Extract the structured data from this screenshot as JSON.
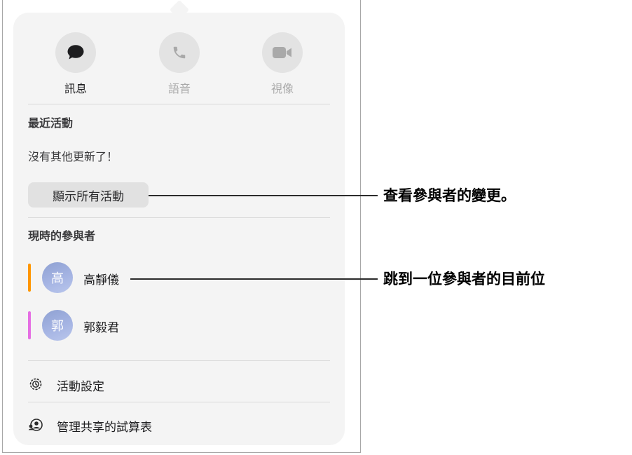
{
  "comm_types": [
    {
      "label": "訊息",
      "icon": "message-bubble-icon",
      "active": true
    },
    {
      "label": "語音",
      "icon": "phone-icon",
      "active": false
    },
    {
      "label": "視像",
      "icon": "video-camera-icon",
      "active": false
    }
  ],
  "recent_activity": {
    "heading": "最近活動",
    "empty_text": "沒有其他更新了！",
    "show_all_button": "顯示所有活動"
  },
  "participants": {
    "heading": "現時的參與者",
    "items": [
      {
        "initial": "高",
        "name": "高靜儀",
        "color": "#ff9500"
      },
      {
        "initial": "郭",
        "name": "郭毅君",
        "color": "#e56ee3"
      }
    ]
  },
  "menu": {
    "activity_settings": "活動設定",
    "manage_shared": "管理共享的試算表"
  },
  "callouts": {
    "view_changes": "查看參與者的變更。",
    "jump_to": "跳到一位參與者的目前位"
  },
  "colors": {
    "popover_bg": "#f4f4f4",
    "icon_active": "#1d1d1f",
    "icon_dim": "#a9a9a9"
  }
}
